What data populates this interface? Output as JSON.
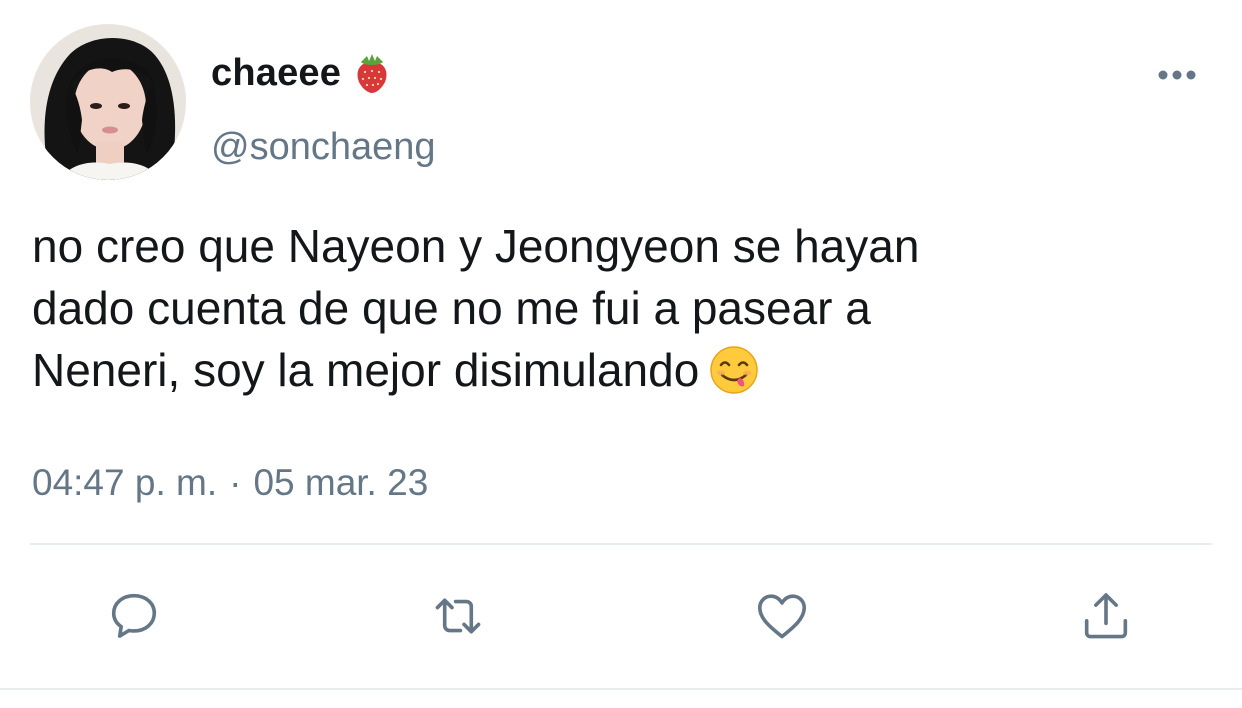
{
  "author": {
    "display_name": "chaeee",
    "name_emoji": "strawberry",
    "handle": "@sonchaeng",
    "avatar": "profile-photo"
  },
  "tweet": {
    "lines": [
      "no creo que Nayeon y Jeongyeon se hayan",
      "dado cuenta de que no me fui a pasear a",
      "Neneri, soy la mejor disimulando"
    ],
    "trailing_emoji": "face-savoring-food"
  },
  "meta": {
    "time": "04:47 p. m.",
    "separator": "·",
    "date": "05 mar. 23"
  },
  "actions": {
    "reply": "reply-icon",
    "retweet": "retweet-icon",
    "like": "like-icon",
    "share": "share-icon"
  },
  "colors": {
    "text": "#14171a",
    "secondary": "#657786",
    "divider": "#e6ecf0",
    "background": "#ffffff"
  }
}
